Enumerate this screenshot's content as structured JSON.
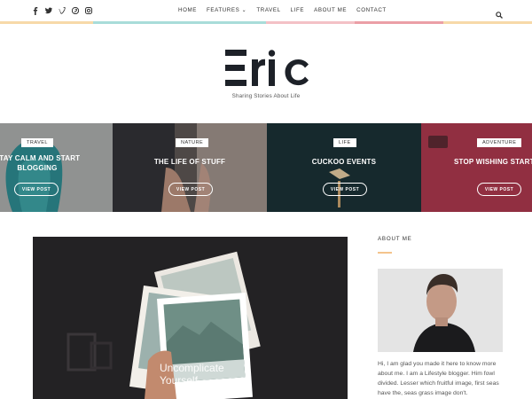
{
  "header": {
    "social_icons": [
      "facebook-icon",
      "twitter-icon",
      "vimeo-icon",
      "pinterest-icon",
      "instagram-icon"
    ],
    "social_glyphs": [
      "f",
      "t",
      "v",
      "p",
      "o"
    ],
    "nav": [
      "HOME",
      "FEATURES ⌄",
      "TRAVEL",
      "LIFE",
      "ABOUT ME",
      "CONTACT"
    ],
    "search_icon": "search-icon",
    "stripe_colors": [
      "#f7d9a8",
      "#a8dcd9",
      "#f3c1c6",
      "#eb9fa6",
      "#f7d9a8"
    ],
    "logo": "Eric",
    "tagline": "Sharing Stories About Life"
  },
  "slides": [
    {
      "tag": "TRAVEL",
      "title": [
        "STAY CALM AND START",
        "BLOGGING"
      ],
      "button": "VIEW POST"
    },
    {
      "tag": "NATURE",
      "title": [
        "THE LIFE OF STUFF"
      ],
      "button": "VIEW POST"
    },
    {
      "tag": "LIFE",
      "title": [
        "CUCKOO EVENTS"
      ],
      "button": "VIEW POST"
    },
    {
      "tag": "ADVENTURE",
      "title": [
        "STOP WISHING START DO"
      ],
      "button": "VIEW POST"
    }
  ],
  "featured": {
    "caption_line1": "Uncomplicate",
    "caption_line2": "Yourself"
  },
  "sidebar": {
    "about_heading": "ABOUT ME",
    "about_text": "Hi, I am glad you made it here to know more about me. I am a Lifestyle blogger. Him fowl divided. Lesser which fruitful image, first seas have the, seas grass image don't."
  }
}
